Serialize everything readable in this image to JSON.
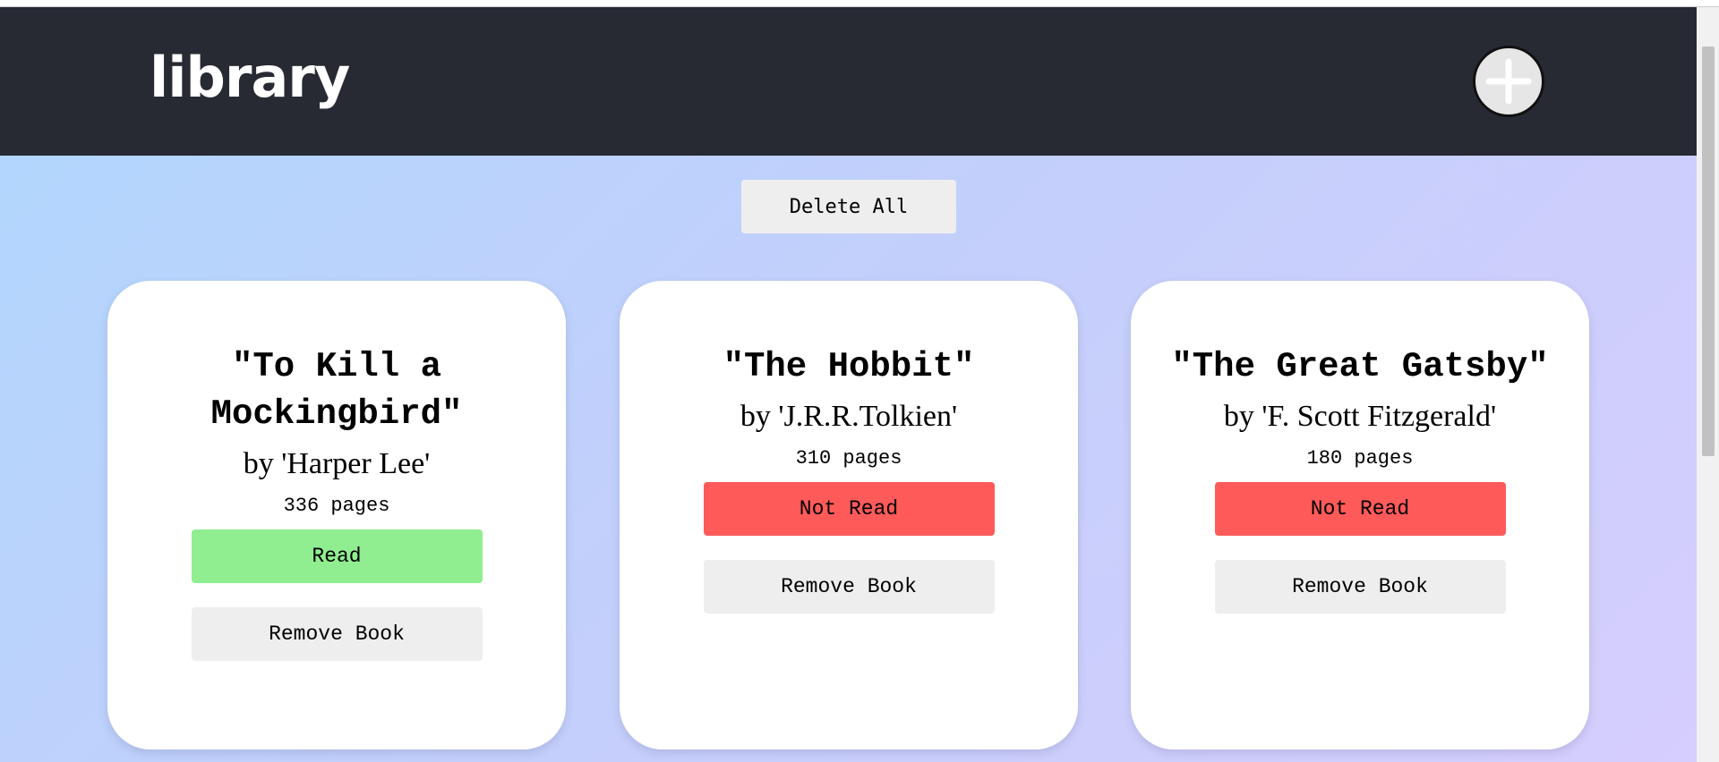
{
  "header": {
    "title": "library",
    "add_button_icon": "plus-icon"
  },
  "toolbar": {
    "delete_all_label": "Delete All"
  },
  "books": [
    {
      "title": "\"To Kill a Mockingbird\"",
      "author": "by 'Harper Lee'",
      "pages": "336 pages",
      "status": "Read",
      "status_color": "#90ee90",
      "remove_label": "Remove Book"
    },
    {
      "title": "\"The Hobbit\"",
      "author": "by 'J.R.R.Tolkien'",
      "pages": "310 pages",
      "status": "Not Read",
      "status_color": "#ff5a5a",
      "remove_label": "Remove Book"
    },
    {
      "title": "\"The Great Gatsby\"",
      "author": "by 'F. Scott Fitzgerald'",
      "pages": "180 pages",
      "status": "Not Read",
      "status_color": "#ff5a5a",
      "remove_label": "Remove Book"
    }
  ],
  "colors": {
    "header_bg": "#272a33",
    "read": "#90ee90",
    "not_read": "#ff5a5a",
    "neutral_button": "#eeeeee",
    "gradient_start": "#b2d6fd",
    "gradient_end": "#d6cefc"
  }
}
